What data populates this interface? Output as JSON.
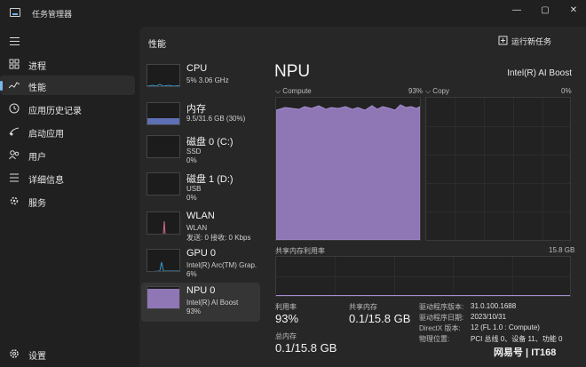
{
  "window": {
    "title": "任务管理器",
    "controls": [
      "—",
      "▢",
      "✕"
    ]
  },
  "sidebar": {
    "items": [
      {
        "label": "进程",
        "icon": "processes-icon"
      },
      {
        "label": "性能",
        "icon": "performance-icon",
        "active": true
      },
      {
        "label": "应用历史记录",
        "icon": "app-history-icon"
      },
      {
        "label": "启动应用",
        "icon": "startup-apps-icon"
      },
      {
        "label": "用户",
        "icon": "users-icon"
      },
      {
        "label": "详细信息",
        "icon": "details-icon"
      },
      {
        "label": "服务",
        "icon": "services-icon"
      }
    ],
    "settings_label": "设置"
  },
  "header": {
    "title": "性能",
    "run_task_label": "运行新任务"
  },
  "resources": [
    {
      "name": "CPU",
      "line1": "5% 3.06 GHz",
      "line2": "",
      "level": 0.05
    },
    {
      "name": "内存",
      "line1": "9.5/31.6 GB (30%)",
      "line2": "",
      "level": 0.3
    },
    {
      "name": "磁盘 0 (C:)",
      "line1": "SSD",
      "line2": "0%",
      "level": 0
    },
    {
      "name": "磁盘 1 (D:)",
      "line1": "USB",
      "line2": "0%",
      "level": 0
    },
    {
      "name": "WLAN",
      "line1": "WLAN",
      "line2": "发送: 0 接收: 0 Kbps",
      "level": 0
    },
    {
      "name": "GPU 0",
      "line1": "Intel(R) Arc(TM) Grap.",
      "line2": "6%",
      "level": 0.06
    },
    {
      "name": "NPU 0",
      "line1": "Intel(R) AI Boost",
      "line2": "93%",
      "level": 0.93,
      "active": true
    }
  ],
  "detail": {
    "device": "NPU",
    "model": "Intel(R) AI Boost",
    "graphs": {
      "compute_label": "Compute",
      "compute_pct": "93%",
      "copy_label": "Copy",
      "copy_pct": "0%",
      "shared_label": "共享内存利用率",
      "shared_max": "15.8 GB"
    },
    "stats": {
      "util_label": "利用率",
      "util_value": "93%",
      "shared_label": "共享内存",
      "shared_value": "0.1/15.8 GB",
      "total_label": "总内存",
      "total_value": "0.1/15.8 GB"
    },
    "info": [
      {
        "key": "驱动程序版本:",
        "value": "31.0.100.1688"
      },
      {
        "key": "驱动程序日期:",
        "value": "2023/10/31"
      },
      {
        "key": "DirectX 版本:",
        "value": "12 (FL 1.0 : Compute)"
      },
      {
        "key": "物理位置:",
        "value": "PCI 总线 0、设备 11、功能 0"
      }
    ]
  },
  "watermark": "网易号 | IT168",
  "colors": {
    "accent": "#76b9ed",
    "npu_fill": "#8f76b5",
    "npu_stroke": "#a58fd0",
    "memory_fill": "#5d6fb5"
  }
}
